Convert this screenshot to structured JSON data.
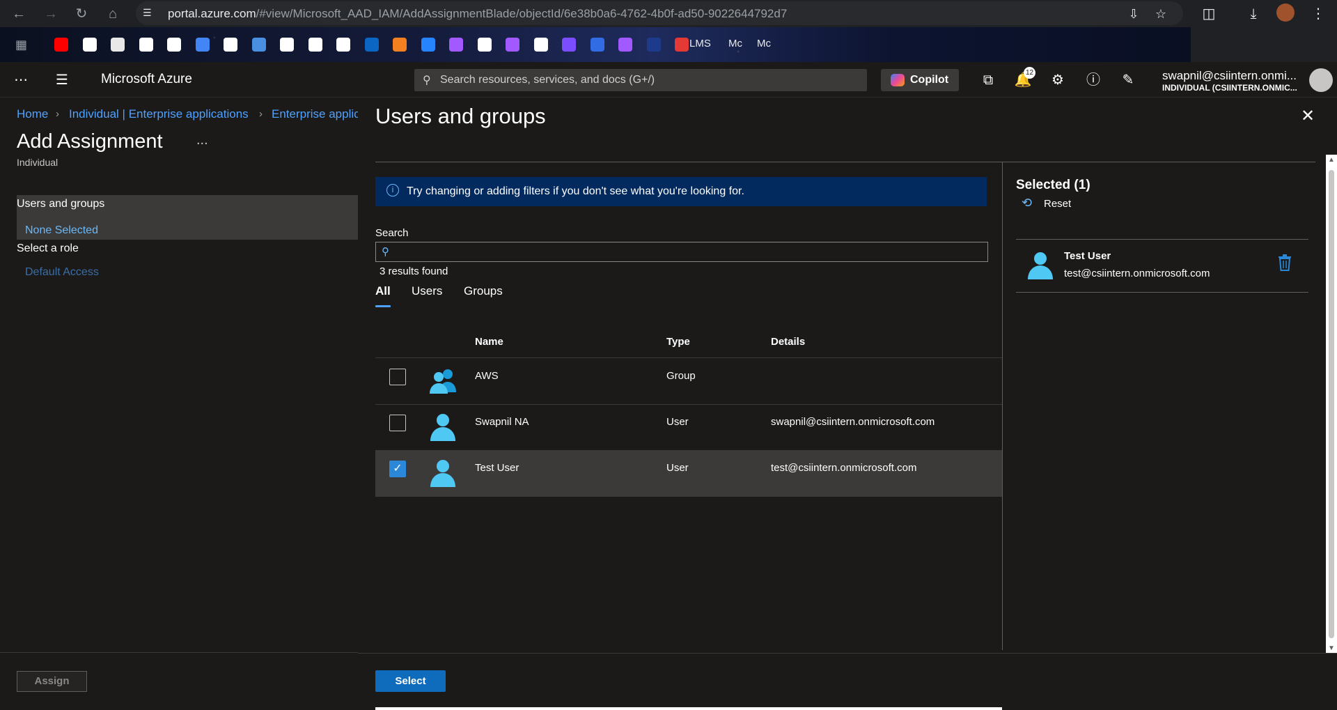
{
  "browser": {
    "url_host": "portal.azure.com",
    "url_path": "/#view/Microsoft_AAD_IAM/AddAssignmentBlade/objectId/6e38b0a6-4762-4b0f-ad50-9022644792d7",
    "bookmark_texts": [
      "LMS",
      "Mc",
      "Mc"
    ],
    "bookmark_colors": [
      "#ff0000",
      "#ffffff",
      "#e8e8e8",
      "#ffffff",
      "#ffffff",
      "#4285f4",
      "#ffffff",
      "#4a90e2",
      "#ffffff",
      "#ffffff",
      "#ffffff",
      "#0a66c2",
      "#f38020",
      "#2684ff",
      "#a259ff",
      "#ffffff",
      "#a259ff",
      "#ffffff",
      "#7c4dff",
      "#326ce5",
      "#a259ff",
      "#1e3a8a",
      "#e53935"
    ]
  },
  "header": {
    "brand": "Microsoft Azure",
    "search_placeholder": "Search resources, services, and docs (G+/)",
    "copilot_label": "Copilot",
    "notification_count": "12",
    "account_email": "swapnil@csiintern.onmi...",
    "account_tenant": "INDIVIDUAL (CSIINTERN.ONMIC..."
  },
  "left_blade": {
    "breadcrumbs": [
      "Home",
      "Individual | Enterprise applications",
      "Enterprise applic"
    ],
    "title": "Add Assignment",
    "more": "...",
    "subtitle": "Individual",
    "users_groups_label": "Users and groups",
    "none_selected": "None Selected",
    "select_role_label": "Select a role",
    "default_access": "Default Access",
    "assign_label": "Assign"
  },
  "panel": {
    "title": "Users and groups",
    "info_text": "Try changing or adding filters if you don't see what you're looking for.",
    "search_label": "Search",
    "search_value": "",
    "results_count": "3 results found",
    "tabs": [
      "All",
      "Users",
      "Groups"
    ],
    "active_tab": "All",
    "columns": {
      "name": "Name",
      "type": "Type",
      "details": "Details"
    },
    "rows": [
      {
        "name": "AWS",
        "type": "Group",
        "details": "",
        "checked": false
      },
      {
        "name": "Swapnil NA",
        "type": "User",
        "details": "swapnil@csiintern.onmicrosoft.com",
        "checked": false
      },
      {
        "name": "Test User",
        "type": "User",
        "details": "test@csiintern.onmicrosoft.com",
        "checked": true
      }
    ],
    "selected_title": "Selected (1)",
    "reset_label": "Reset",
    "selected_item": {
      "name": "Test User",
      "email": "test@csiintern.onmicrosoft.com"
    },
    "select_label": "Select"
  }
}
